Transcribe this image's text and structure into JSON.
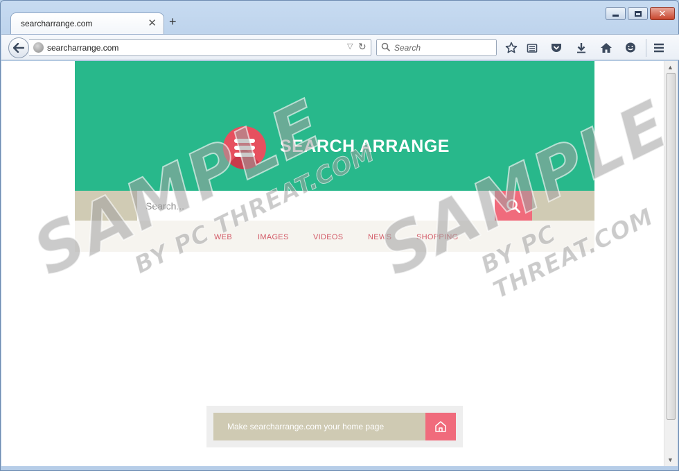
{
  "tab": {
    "title": "searcharrange.com"
  },
  "toolbar": {
    "url": "searcharrange.com",
    "search_placeholder": "Search"
  },
  "page": {
    "brand": "SEARCH ARRANGE",
    "search_placeholder": "Search...",
    "nav": [
      {
        "label": "WEB"
      },
      {
        "label": "IMAGES"
      },
      {
        "label": "VIDEOS"
      },
      {
        "label": "NEWS"
      },
      {
        "label": "SHOPPING"
      }
    ],
    "home_prompt": "Make searcharrange.com your home page"
  },
  "watermark": {
    "main": "SAMPLE",
    "sub": "BY PC THREAT.COM"
  },
  "colors": {
    "hero": "#28b88b",
    "accent": "#f06b7c",
    "strip": "#d0cbb4",
    "nav_text": "#d25966"
  }
}
